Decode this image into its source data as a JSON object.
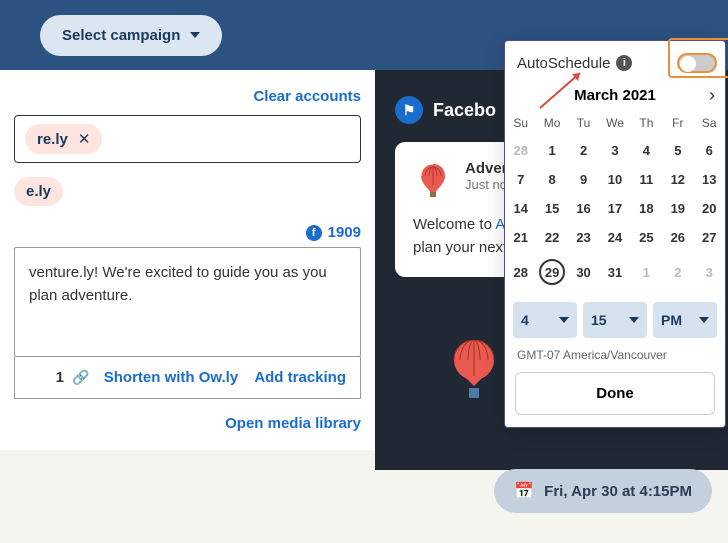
{
  "topbar": {
    "campaign_button": "Select campaign"
  },
  "composer": {
    "clear_accounts": "Clear accounts",
    "account_pill": "re.ly",
    "account_pill2": "e.ly",
    "fb_count": "1909",
    "message": "venture.ly! We're excited to guide you as you plan adventure.",
    "link_count": "1",
    "shorten": "Shorten with Ow.ly",
    "add_tracking": "Add tracking",
    "media_library": "Open media library"
  },
  "preview": {
    "network": "Facebo",
    "page_name": "Advent",
    "time": "Just nov",
    "body_prefix": "Welcome to ",
    "body_link": "Ac",
    "body_line2": "plan your next"
  },
  "picker": {
    "auto_label": "AutoSchedule",
    "month": "March 2021",
    "weekdays": [
      "Su",
      "Mo",
      "Tu",
      "We",
      "Th",
      "Fr",
      "Sa"
    ],
    "weeks": [
      [
        {
          "d": "28",
          "dim": true
        },
        {
          "d": "1"
        },
        {
          "d": "2"
        },
        {
          "d": "3"
        },
        {
          "d": "4"
        },
        {
          "d": "5"
        },
        {
          "d": "6"
        }
      ],
      [
        {
          "d": "7"
        },
        {
          "d": "8"
        },
        {
          "d": "9"
        },
        {
          "d": "10"
        },
        {
          "d": "11"
        },
        {
          "d": "12"
        },
        {
          "d": "13"
        }
      ],
      [
        {
          "d": "14"
        },
        {
          "d": "15"
        },
        {
          "d": "16"
        },
        {
          "d": "17"
        },
        {
          "d": "18"
        },
        {
          "d": "19"
        },
        {
          "d": "20"
        }
      ],
      [
        {
          "d": "21"
        },
        {
          "d": "22"
        },
        {
          "d": "23"
        },
        {
          "d": "24"
        },
        {
          "d": "25"
        },
        {
          "d": "26"
        },
        {
          "d": "27"
        }
      ],
      [
        {
          "d": "28"
        },
        {
          "d": "29",
          "sel": true
        },
        {
          "d": "30"
        },
        {
          "d": "31"
        },
        {
          "d": "1",
          "dim": true
        },
        {
          "d": "2",
          "dim": true
        },
        {
          "d": "3",
          "dim": true
        }
      ]
    ],
    "hour": "4",
    "minute": "15",
    "ampm": "PM",
    "tz": "GMT-07 America/Vancouver",
    "done": "Done"
  },
  "schedule_pill": "Fri, Apr 30 at 4:15PM"
}
